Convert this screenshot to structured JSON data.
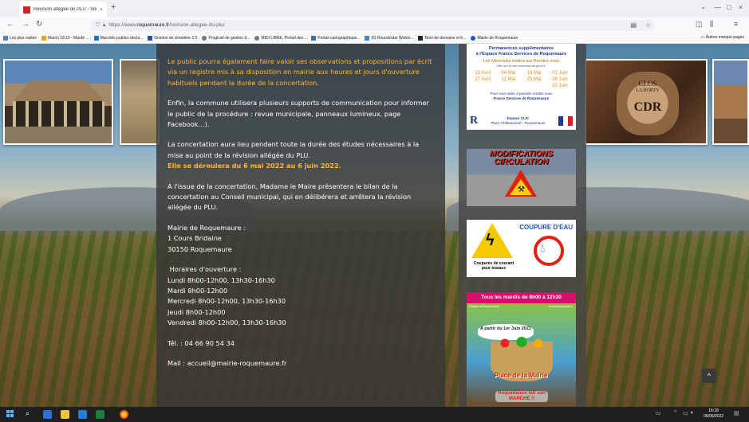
{
  "browser": {
    "tab_title": "Révision allégée du PLU - Site ...",
    "tab_close": "×",
    "new_tab": "+",
    "url_prefix": "https://www.",
    "url_domain": "roquemaure.fr",
    "url_path": "/revision-allegee-du-plu/",
    "window_controls": [
      "—",
      "□",
      "×"
    ],
    "bookmarks": [
      "Les plus visités",
      "March 18.10 - Marité ...",
      "Marchés publics decla...",
      "Gestion de cimetière 2.0",
      "Progiciel de gestion d...",
      "MIDI LIBRE, Portail des...",
      "Portail cartographique...",
      "(6) Roundcube Webm...",
      "Nom de domaine et h...",
      "Mairie de Roquemaure"
    ],
    "other_bookmarks": "Autres marque-pages"
  },
  "content": {
    "para1": "Le public pourra également faire valoir ses observations et propositions par écrit via un registre mis à sa disposition en mairie aux heures et jours d'ouverture habituels pendant la durée de la concertation.",
    "para2": "Enfin, la commune utilisera plusieurs supports de communication pour informer le public de la procédure : revue municipale, panneaux lumineux, page Facebook…).",
    "para3": "La concertation aura lieu pendant toute la durée des études nécessaires à la mise au point de la révision allégée du PLU.",
    "para3_dates": "Elle se déroulera du 6 mai 2022 au 6 juin 2022.",
    "para4": "A l'issue de la concertation, Madame le Maire présentera le bilan de la concertation au Conseil municipal, qui en délibérera et arrêtera la révision allégée du PLU.",
    "address": [
      "Mairie de Roquemaure :",
      "1 Cours Bridaine",
      "30150 Roquemaure"
    ],
    "hours_title": " Horaires d'ouverture :",
    "hours": [
      "Lundi 8h00-12h00, 13h30-16h30",
      "Mardi 8h00-12h00",
      "Mercredi 8h00-12h00, 13h30-16h30",
      "Jeudi 8h00-12h00",
      "Vendredi 8h00-12h00, 13h30-16h30"
    ],
    "phone": "Tél. : 04 66 90 54 34",
    "mail": "Mail : accueil@mairie-roquemaure.fr"
  },
  "sidebar": {
    "card1": {
      "head1": "Permanences supplémentaires",
      "head2": "à l'Espace France Services de Roquemaure",
      "sub": "Les Mercredis matins sur Rendez-vous",
      "mini": "Rdv sur le site www.impots.gouv.fr",
      "dates": [
        "13 Avril",
        "04 Mai",
        "18 Mai",
        "01 Juin",
        "27 Avril",
        "11 Mai",
        "25 Mai",
        "08 Juin",
        "",
        "",
        "",
        "22 Juin"
      ],
      "help1": "Pour vous aider à prendre rendez-vous",
      "help2": "France Services de Roquemaure",
      "help3": "Espace CLIC",
      "help4": "Place Châteauneuf - Roquemaure",
      "logo": "R"
    },
    "card2_title": "MODIFICATIONS CIRCULATION",
    "card3": {
      "title": "COUPURE D'EAU",
      "caption": "Coupures de courant pour travaux"
    },
    "card4": {
      "title": "Tous les mardis  de 8h00 à 12h30",
      "fb_left": "f  Mairie-de-Roquemaure",
      "fb_right": "www.roquemaure.fr",
      "date": "A partir du 1er Juin 2021",
      "place": "Place de la Mairie",
      "marche": "Roquemaure fait son MARCHÉ !!"
    }
  },
  "barrel": {
    "line1": "CLOS",
    "line2": "LA BORTY",
    "line3": "CDR"
  },
  "scroll_top": "^",
  "taskbar": {
    "time": "16:18",
    "date": "06/05/2022"
  },
  "colors": {
    "accent": "#ffb52e",
    "panel": "#373737"
  }
}
